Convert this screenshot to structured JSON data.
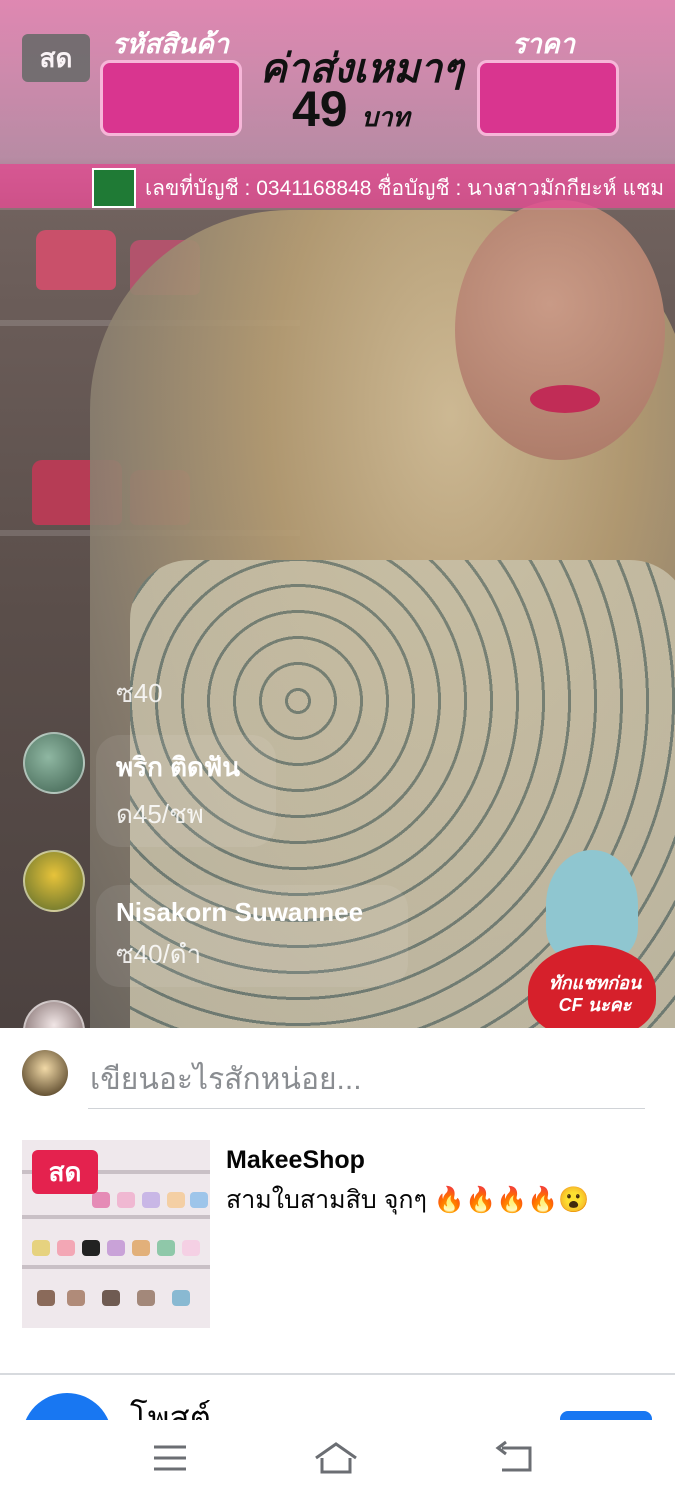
{
  "video": {
    "live_badge": "สด",
    "banner": {
      "left_label": "รหัสสินค้า",
      "right_label": "ราคา",
      "center_line1": "ค่าส่งเหมาๆ",
      "center_price": "49",
      "center_unit": "บาท",
      "account_text": "เลขที่บัญชี : 0341168848   ชื่อบัญชี : นางสาวมักกียะห์ แชม"
    },
    "comments": [
      {
        "name": "",
        "message": "ซ40"
      },
      {
        "name": "พริก ติดฟัน",
        "message": "ด45/ชพ"
      },
      {
        "name": "Nisakorn Suwannee",
        "message": "ซ40/ดำ"
      }
    ],
    "sticker_text": "ทักแชทก่อน CF นะคะ"
  },
  "composer": {
    "placeholder": "เขียนอะไรสักหน่อย..."
  },
  "post": {
    "live_badge": "สด",
    "page_name": "MakeeShop",
    "caption": "สามใบสามสิบ จุกๆ 🔥🔥🔥🔥😮"
  },
  "bottom": {
    "post_label": "โพสต์"
  },
  "icons": [
    "menu-icon",
    "home-icon",
    "back-icon"
  ],
  "colors": {
    "facebook_blue": "#1877f2",
    "live_red": "#e4224e",
    "banner_pink": "#d9358f"
  }
}
